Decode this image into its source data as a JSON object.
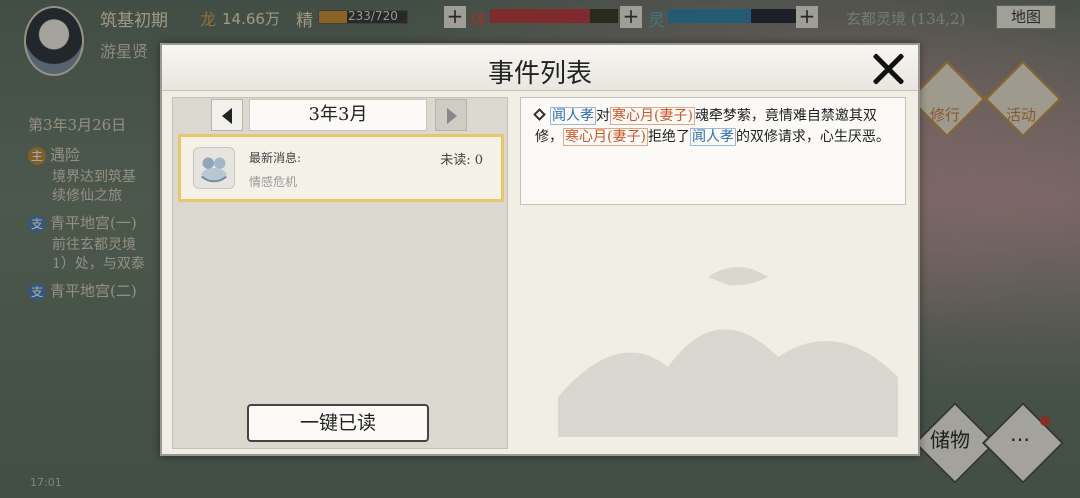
{
  "hud": {
    "realm": "筑基初期",
    "money_icon": "龙",
    "money": "14.66万",
    "jing_label": "精",
    "jing_text": "233/720",
    "ti_label": "体",
    "ling_label": "灵",
    "plus": "+",
    "location": "玄都灵境 (134,2)",
    "map_button": "地图",
    "player_name": "游星贤",
    "jing_fraction": 0.32,
    "ti_fraction": 0.78,
    "ling_fraction": 0.65
  },
  "quest_log": {
    "date": "第3年3月26日",
    "q1_tag": "主",
    "q1_title": "遇险",
    "q1_desc_1": "境界达到筑基",
    "q1_desc_2": "续修仙之旅",
    "q2_tag": "支",
    "q2_title": "青平地宫(一)",
    "q2_desc_1": "前往玄都灵境",
    "q2_desc_2": "1）处，与双泰",
    "q3_tag": "支",
    "q3_title": "青平地宫(二)"
  },
  "side_icons": {
    "practice": "修行",
    "activity": "活动",
    "storage": "储物",
    "more": "⋯"
  },
  "status_bar": {
    "time": "17:01"
  },
  "modal": {
    "title": "事件列表",
    "month": "3年3月",
    "event": {
      "latest_label": "最新消息:",
      "unread": "未读: 0",
      "name": "情感危机",
      "icon": "emotion-icon"
    },
    "read_all_button": "一键已读",
    "message": {
      "name_a": "闻人孝",
      "t1": "对",
      "name_b": "寒心月(妻子)",
      "t2": "魂牵梦萦，竟情难自禁邀其双修，",
      "name_b2": "寒心月(妻子)",
      "t3": "拒绝了",
      "name_a2": "闻人孝",
      "t4": "的双修请求，心生厌恶。"
    }
  }
}
